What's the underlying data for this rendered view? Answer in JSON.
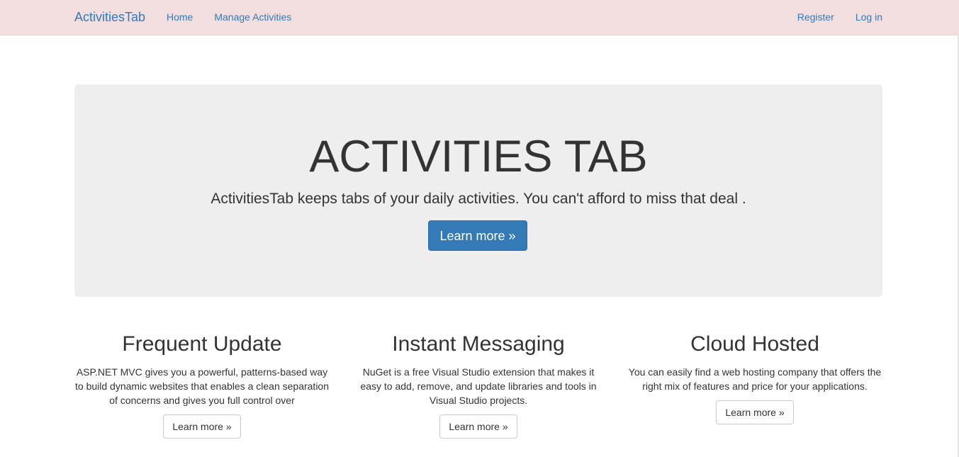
{
  "navbar": {
    "brand": "ActivitiesTab",
    "left_links": [
      "Home",
      "Manage Activities"
    ],
    "right_links": [
      "Register",
      "Log in"
    ],
    "background_color": "#f2dede",
    "link_color": "#337ab7"
  },
  "jumbotron": {
    "title": "ACTIVITIES TAB",
    "lead": "ActivitiesTab keeps tabs of your daily activities. You can't afford to miss that deal .",
    "button_label": "Learn more »",
    "button_color": "#337ab7"
  },
  "columns": [
    {
      "heading": "Frequent Update",
      "text": "ASP.NET MVC gives you a powerful, patterns-based way to build dynamic websites that enables a clean separation of concerns and gives you full control over",
      "button_label": "Learn more »"
    },
    {
      "heading": "Instant Messaging",
      "text": "NuGet is a free Visual Studio extension that makes it easy to add, remove, and update libraries and tools in Visual Studio projects.",
      "button_label": "Learn more »"
    },
    {
      "heading": "Cloud Hosted",
      "text": "You can easily find a web hosting company that offers the right mix of features and price for your applications.",
      "button_label": "Learn more »"
    }
  ]
}
